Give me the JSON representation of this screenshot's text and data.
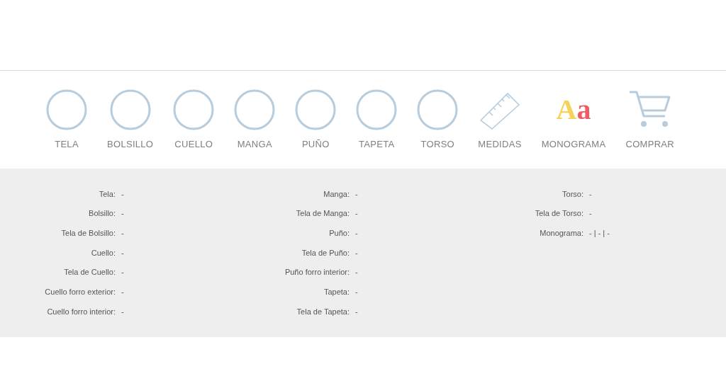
{
  "steps": [
    {
      "label": "TELA",
      "kind": "circle"
    },
    {
      "label": "BOLSILLO",
      "kind": "circle"
    },
    {
      "label": "CUELLO",
      "kind": "circle"
    },
    {
      "label": "MANGA",
      "kind": "circle"
    },
    {
      "label": "PUÑO",
      "kind": "circle"
    },
    {
      "label": "TAPETA",
      "kind": "circle"
    },
    {
      "label": "TORSO",
      "kind": "circle"
    },
    {
      "label": "MEDIDAS",
      "kind": "ruler"
    },
    {
      "label": "MONOGRAMA",
      "kind": "monogram",
      "glyphs": [
        "A",
        "a"
      ]
    },
    {
      "label": "COMPRAR",
      "kind": "cart"
    }
  ],
  "summary": {
    "columns": [
      [
        {
          "field": "Tela:",
          "value": "-"
        },
        {
          "field": "Bolsillo:",
          "value": "-"
        },
        {
          "field": "Tela de Bolsillo:",
          "value": "-"
        },
        {
          "field": "Cuello:",
          "value": "-"
        },
        {
          "field": "Tela de Cuello:",
          "value": "-"
        },
        {
          "field": "Cuello forro exterior:",
          "value": "-"
        },
        {
          "field": "Cuello forro interior:",
          "value": "-"
        }
      ],
      [
        {
          "field": "Manga:",
          "value": "-"
        },
        {
          "field": "Tela de Manga:",
          "value": "-"
        },
        {
          "field": "Puño:",
          "value": "-"
        },
        {
          "field": "Tela de Puño:",
          "value": "-"
        },
        {
          "field": "Puño forro interior:",
          "value": "-"
        },
        {
          "field": "Tapeta:",
          "value": "-"
        },
        {
          "field": "Tela de Tapeta:",
          "value": "-"
        }
      ],
      [
        {
          "field": "Torso:",
          "value": "-"
        },
        {
          "field": "Tela de Torso:",
          "value": "-"
        },
        {
          "field": "Monograma:",
          "value": "- | - | -"
        }
      ]
    ]
  }
}
